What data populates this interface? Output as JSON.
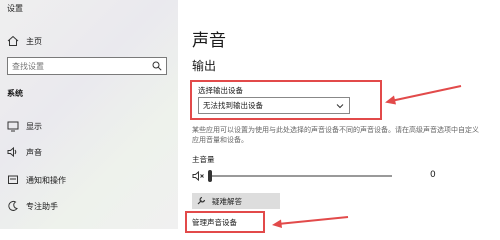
{
  "window": {
    "title": "设置"
  },
  "sidebar": {
    "home_label": "主页",
    "search_placeholder": "查找设置",
    "section_label": "系统",
    "items": [
      {
        "label": "显示",
        "icon": "display-icon"
      },
      {
        "label": "声音",
        "icon": "sound-icon",
        "active": true
      },
      {
        "label": "通知和操作",
        "icon": "notification-icon"
      },
      {
        "label": "专注助手",
        "icon": "focus-assist-icon"
      }
    ]
  },
  "main": {
    "title": "声音",
    "output_heading": "输出",
    "select_output_label": "选择输出设备",
    "output_device_value": "无法找到输出设备",
    "description": "某些应用可以设置为使用与此处选择的声音设备不同的声音设备。请在高级声音选项中自定义应用音量和设备。",
    "master_volume_label": "主音量",
    "volume_value": "0",
    "volume_level": 0,
    "troubleshoot_label": "疑难解答",
    "manage_devices_label": "管理声音设备"
  },
  "colors": {
    "annotation_red": "#e24a4a"
  }
}
